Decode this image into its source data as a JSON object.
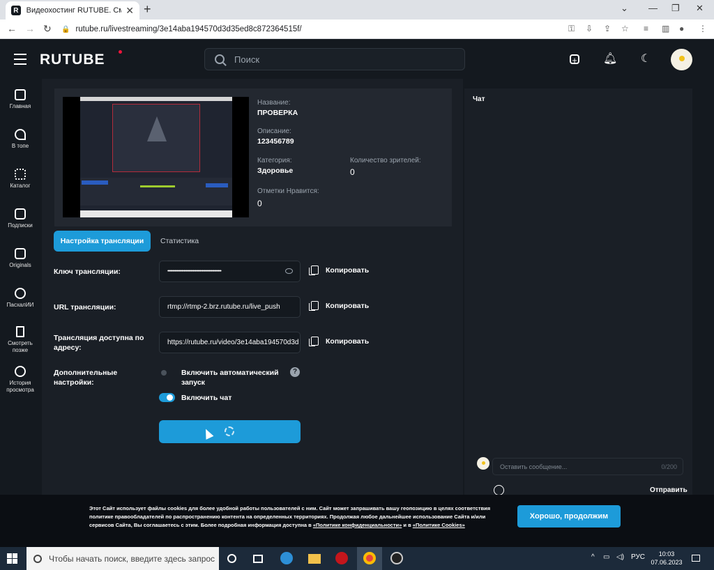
{
  "browser": {
    "tab_title": "Видеохостинг RUTUBE. Смотрите",
    "favicon_letter": "R",
    "url": "rutube.ru/livestreaming/3e14aba194570d3d35ed8c872364515f/"
  },
  "header": {
    "logo": "RUTUBE",
    "search_placeholder": "Поиск"
  },
  "sidebar": {
    "items": [
      {
        "label": "Главная",
        "icon": "home-icon"
      },
      {
        "label": "В топе",
        "icon": "rocket-icon"
      },
      {
        "label": "Каталог",
        "icon": "grid-icon"
      },
      {
        "label": "Подписки",
        "icon": "play-icon"
      },
      {
        "label": "Originals",
        "icon": "originals-icon"
      },
      {
        "label": "ПасхалИИ",
        "icon": "rabbit-icon"
      },
      {
        "label": "Смотреть позже",
        "icon": "bookmark-icon"
      },
      {
        "label": "История просмотра",
        "icon": "history-icon"
      }
    ]
  },
  "stream": {
    "name_label": "Название:",
    "name_value": "ПРОВЕРКА",
    "description_label": "Описание:",
    "description_value": "123456789",
    "category_label": "Категория:",
    "category_value": "Здоровье",
    "viewers_label": "Количество зрителей:",
    "viewers_value": "0",
    "likes_label": "Отметки Нравится:",
    "likes_value": "0"
  },
  "tabs": {
    "settings": "Настройка трансляции",
    "stats": "Статистика"
  },
  "settings": {
    "key_label": "Ключ трансляции:",
    "key_value": "•••••••••••••••••••••••••••••••••••••••••••••••••••••",
    "url_label": "URL трансляции:",
    "url_value": "rtmp://rtmp-2.brz.rutube.ru/live_push",
    "address_label": "Трансляция доступна по адресу:",
    "address_value": "https://rutube.ru/video/3e14aba194570d3d",
    "copy_label": "Копировать",
    "extra_label": "Дополнительные настройки:",
    "autostart_label": "Включить автоматический запуск",
    "autostart_on": false,
    "chat_label": "Включить чат",
    "chat_on": true
  },
  "chat": {
    "title": "Чат",
    "input_placeholder": "Оставить сообщение...",
    "counter": "0/200",
    "send_label": "Отправить"
  },
  "cookie": {
    "text": "Этот Сайт использует файлы cookies для более удобной работы пользователей с ним. Сайт может запрашивать вашу геопозицию в целях соответствия политике правообладателей по распространению контента на определенных территориях. Продолжая любое дальнейшее использование Сайта и/или сервисов Сайта, Вы соглашаетесь с этим. Более подробная информация доступна в",
    "privacy_link": "«Политике конфиденциальности»",
    "and": "и в",
    "cookies_link": "«Политике Cookies»",
    "accept_label": "Хорошо, продолжим"
  },
  "taskbar": {
    "search_placeholder": "Чтобы начать поиск, введите здесь запрос",
    "lang": "РУС",
    "time": "10:03",
    "date": "07.06.2023"
  },
  "colors": {
    "accent": "#1d9bd9",
    "background": "#14191f",
    "panel": "#1a1f26",
    "brand_dot": "#ed143b"
  }
}
